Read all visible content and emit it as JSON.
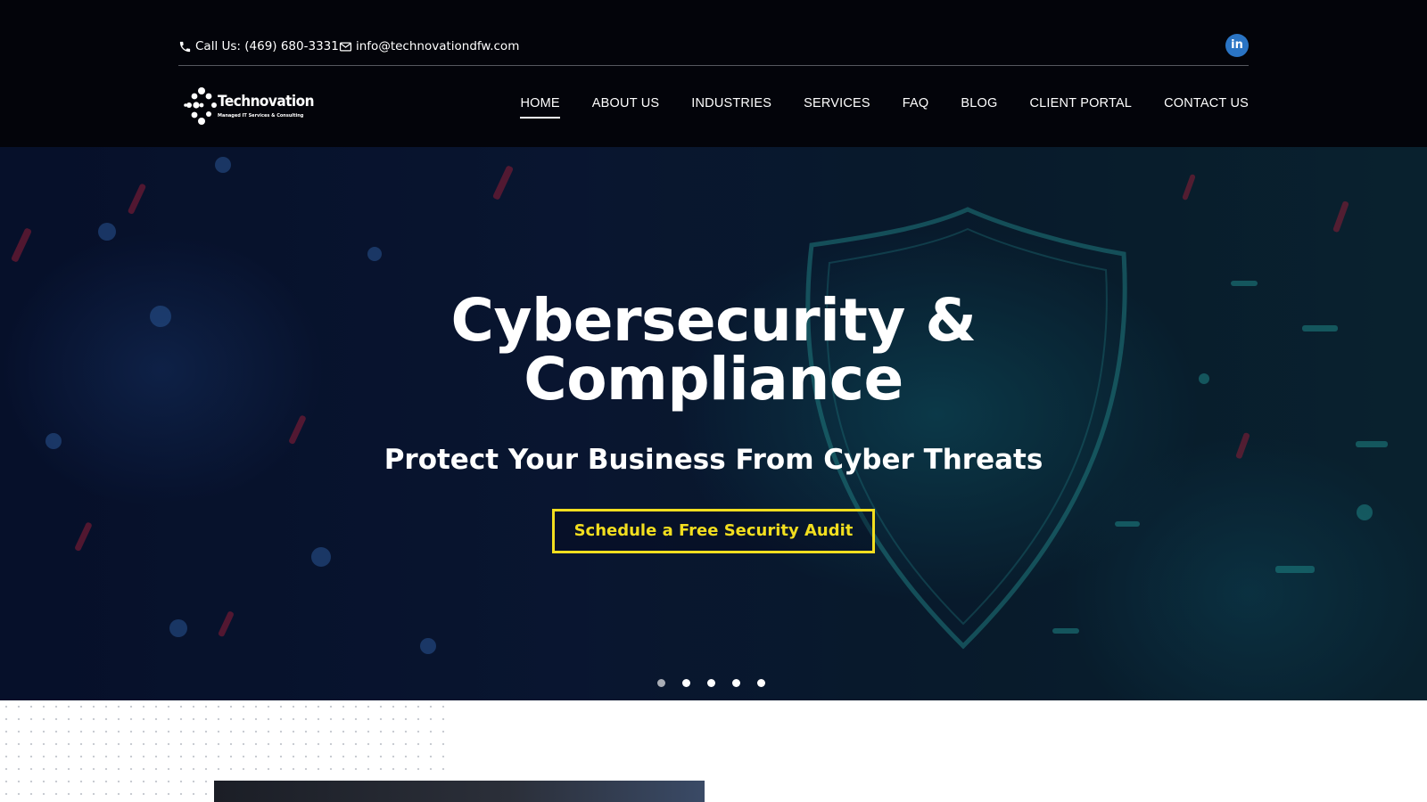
{
  "topbar": {
    "phone_label": "Call Us: (469) 680-3331",
    "email_label": "info@technovationdfw.com",
    "social": [
      {
        "icon": "linkedin-icon",
        "label": "in"
      }
    ]
  },
  "logo": {
    "word": "Technovation",
    "tagline": "Managed IT Services & Consulting"
  },
  "nav": {
    "items": [
      {
        "label": "HOME",
        "active": true
      },
      {
        "label": "ABOUT US"
      },
      {
        "label": "INDUSTRIES"
      },
      {
        "label": "SERVICES"
      },
      {
        "label": "FAQ"
      },
      {
        "label": "BLOG"
      },
      {
        "label": "CLIENT PORTAL"
      },
      {
        "label": "CONTACT US"
      }
    ]
  },
  "hero": {
    "title_line1": "Cybersecurity &",
    "title_line2": "Compliance",
    "subtitle": "Protect Your Business From Cyber Threats",
    "cta_label": "Schedule a Free Security Audit",
    "slide_count": 5,
    "active_slide": 1
  },
  "colors": {
    "header_bg": "#03040a",
    "accent": "#f2de1f",
    "linkedin": "#2a74c4"
  }
}
